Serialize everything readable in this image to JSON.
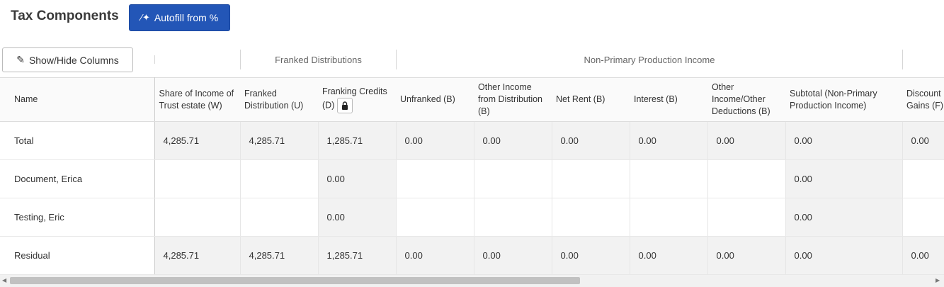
{
  "header": {
    "title": "Tax Components",
    "autofill_label": "Autofill from %",
    "showhide_label": "Show/Hide Columns"
  },
  "groups": {
    "franked": "Franked Distributions",
    "nonprimary": "Non-Primary Production Income"
  },
  "columns": [
    "Name",
    "Share of Income of Trust estate (W)",
    "Franked Distribution (U)",
    "Franking Credits (D)",
    "Unfranked (B)",
    "Other Income from Distribution (B)",
    "Net Rent (B)",
    "Interest (B)",
    "Other Income/Other Deductions (B)",
    "Subtotal (Non-Primary Production Income)",
    "Discount Gains (F)"
  ],
  "rows": [
    {
      "name": "Total",
      "cells": [
        "4,285.71",
        "4,285.71",
        "1,285.71",
        "0.00",
        "0.00",
        "0.00",
        "0.00",
        "0.00",
        "0.00",
        "0.00"
      ]
    },
    {
      "name": "Document, Erica",
      "cells": [
        "",
        "",
        "0.00",
        "",
        "",
        "",
        "",
        "",
        "0.00",
        ""
      ]
    },
    {
      "name": "Testing, Eric",
      "cells": [
        "",
        "",
        "0.00",
        "",
        "",
        "",
        "",
        "",
        "0.00",
        ""
      ]
    },
    {
      "name": "Residual",
      "cells": [
        "4,285.71",
        "4,285.71",
        "1,285.71",
        "0.00",
        "0.00",
        "0.00",
        "0.00",
        "0.00",
        "0.00",
        "0.00"
      ]
    }
  ],
  "colors": {
    "primary": "#2356b7",
    "header_bg": "#fafafa",
    "shade": "#f2f2f2"
  }
}
